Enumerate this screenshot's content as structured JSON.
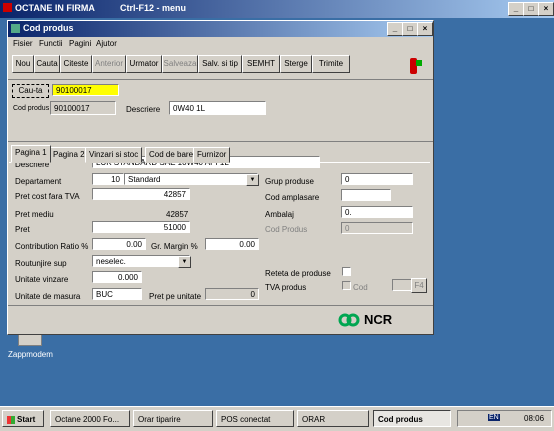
{
  "outer": {
    "title": "OCTANE IN FIRMA",
    "subtitle": "Ctrl-F12 - menu"
  },
  "window": {
    "title": "Cod produs"
  },
  "menu": [
    "Fisier",
    "Functii",
    "Pagini",
    "Ajutor"
  ],
  "toolbar": [
    "Nou",
    "Cauta",
    "Citeste",
    "Anterior",
    "Urmator",
    "Salveaza",
    "Salv. si tip",
    "SEMHT",
    "Sterge",
    "Trimite"
  ],
  "toolbar_disabled": [
    "Anterior",
    "Salveaza"
  ],
  "search": {
    "button": "Cau-ta",
    "value": "90100017"
  },
  "header": {
    "cod_label": "Cod produs",
    "cod_value": "90100017",
    "descr_label": "Descriere",
    "descr_value": "0W40 1L"
  },
  "tabs": [
    "Pagina 1",
    "Pagina 2",
    "Vinzari si stoc",
    "Cod de bare",
    "Furnizor"
  ],
  "form": {
    "descriere_label": "Descriere",
    "descriere_value": "LUK STANDARD SAE 10W40 API 1L",
    "departament_label": "Departament",
    "departament_code": "10",
    "departament_value": "Standard",
    "pret_cost_label": "Pret cost fara TVA",
    "pret_cost_value": "42857",
    "pret_mediu_label": "Pret mediu",
    "pret_mediu_value": "42857",
    "pret_label": "Pret",
    "pret_value": "51000",
    "contrib_label": "Contribution Ratio %",
    "contrib_value": "0.00",
    "gr_margin_label": "Gr. Margin %",
    "gr_margin_value": "0.00",
    "rotunjire_label": "Routunjire sup",
    "rotunjire_value": "neselec.",
    "unitate_vinzare_label": "Unitate vinzare",
    "unitate_vinzare_value": "0.000",
    "unitate_masura_label": "Unitate de masura",
    "unitate_masura_value": "BUC",
    "pret_unitate_label": "Pret pe unitate",
    "pret_unitate_value": "0",
    "grup_label": "Grup produse",
    "grup_value": "0",
    "cod_ampl_label": "Cod amplasare",
    "cod_ampl_value": "",
    "ambalaj_label": "Ambalaj",
    "ambalaj_value": "0.",
    "cod_produs2_label": "Cod Produs",
    "cod_produs2_value": "0",
    "reteta_label": "Reteta de produse",
    "tva_label": "TVA produs",
    "tva_cod_label": "Cod",
    "tva_btn": "F4"
  },
  "logo": "NCR",
  "desktop_icon": "Zappmodem",
  "taskbar": {
    "start": "Start",
    "tasks": [
      "Octane 2000 Fo...",
      "Orar tiparire",
      "POS conectat",
      "ORAR",
      "Cod produs"
    ],
    "lang": "EN",
    "clock": "08:06"
  }
}
